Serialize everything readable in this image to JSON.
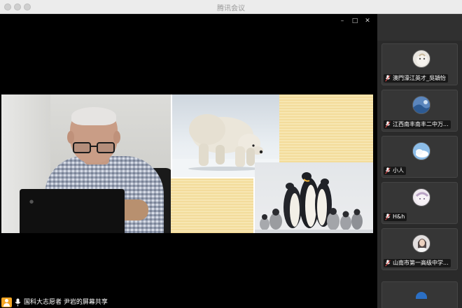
{
  "window": {
    "title": "腾讯会议"
  },
  "main": {
    "controls": {
      "minimize": "–",
      "maximize": "□",
      "close": "✕"
    }
  },
  "bottombar": {
    "share_label": "国科大志愿者 尹岩的屏幕共享"
  },
  "participants": [
    {
      "name": "澳門濠江英才_吳穎怡",
      "avatar_color": "#e9e6e0"
    },
    {
      "name": "江西南丰南丰二中万...",
      "avatar_color": "#3a6ea8"
    },
    {
      "name": "小人",
      "avatar_color": "#7fb2e0"
    },
    {
      "name": "H&h",
      "avatar_color": "#efe9ef"
    },
    {
      "name": "山南市第一高级中学...",
      "avatar_color": "#d9d4d4"
    }
  ],
  "colors": {
    "titlebar": "#ececec",
    "panel": "#2a2a2a",
    "user_icon": "#f5a623",
    "slide_yellow": "#f3dc9b"
  }
}
